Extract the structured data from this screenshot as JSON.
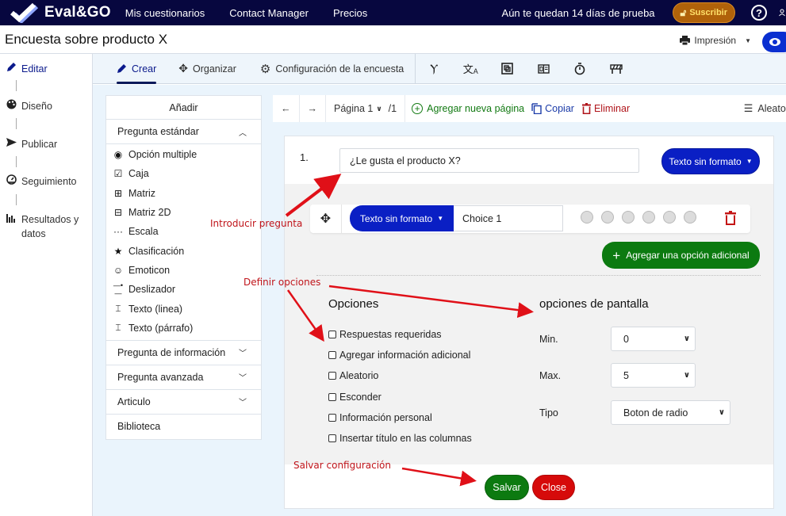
{
  "topnav": {
    "brand": "Eval&GO",
    "links": [
      "Mis cuestionarios",
      "Contact Manager",
      "Precios"
    ],
    "trial_text": "Aún te quedan 14 días de prueba",
    "subscribe_label": "Suscribir",
    "help_icon": "?"
  },
  "titlebar": {
    "survey_title": "Encuesta sobre producto X",
    "print_label": "Impresión"
  },
  "leftnav": {
    "items": [
      {
        "label": "Editar",
        "icon": "pencil-icon",
        "active": true
      },
      {
        "label": "Diseño",
        "icon": "palette-icon"
      },
      {
        "label": "Publicar",
        "icon": "send-icon"
      },
      {
        "label": "Seguimiento",
        "icon": "gauge-icon"
      },
      {
        "label": "Resultados y datos",
        "icon": "bar-chart-icon"
      }
    ]
  },
  "tabs": {
    "items": [
      {
        "label": "Crear",
        "icon": "pencil-icon",
        "active": true
      },
      {
        "label": "Organizar",
        "icon": "move-icon"
      },
      {
        "label": "Configuración de la encuesta",
        "icon": "gear-icon"
      }
    ],
    "tool_icons": [
      "branch-icon",
      "translate-icon",
      "frame-icon",
      "id-card-icon",
      "stopwatch-icon",
      "barrier-icon"
    ]
  },
  "addpanel": {
    "header": "Añadir",
    "standard_section": "Pregunta estándar",
    "question_types": [
      {
        "label": "Opción multiple",
        "icon": "◉"
      },
      {
        "label": "Caja",
        "icon": "☑"
      },
      {
        "label": "Matriz",
        "icon": "⊞"
      },
      {
        "label": "Matriz 2D",
        "icon": "⊟"
      },
      {
        "label": "Escala",
        "icon": "···"
      },
      {
        "label": "Clasificación",
        "icon": "★"
      },
      {
        "label": "Emoticon",
        "icon": "☺"
      },
      {
        "label": "Deslizador",
        "icon": "-•-"
      },
      {
        "label": "Texto (linea)",
        "icon": "⌶"
      },
      {
        "label": "Texto (párrafo)",
        "icon": "⌶"
      }
    ],
    "sections": [
      "Pregunta de información",
      "Pregunta avanzada",
      "Articulo"
    ],
    "library": "Biblioteca"
  },
  "pagebar": {
    "page_label": "Página 1",
    "page_total": "/1",
    "add_page": "Agregar nueva página",
    "copy": "Copiar",
    "delete": "Eliminar",
    "randomize": "Aleatoriz"
  },
  "question": {
    "number": "1.",
    "text": "¿Le gusta el producto X?",
    "format_label": "Texto sin formato",
    "choice_format_label": "Texto sin formato",
    "choice_value": "Choice 1",
    "radio_count": 6,
    "add_option_label": "Agregar una opción adicional"
  },
  "options": {
    "title": "Opciones",
    "items": [
      {
        "label": "Respuestas requeridas",
        "checked": false
      },
      {
        "label": "Agregar información adicional",
        "checked": false
      },
      {
        "label": "Aleatorio",
        "checked": false
      },
      {
        "label": "Esconder",
        "checked": false
      },
      {
        "label": "Información personal",
        "checked": false
      },
      {
        "label": "Insertar título en las columnas",
        "checked": false
      }
    ]
  },
  "display": {
    "title": "opciones de pantalla",
    "min_label": "Min.",
    "min_value": "0",
    "max_label": "Max.",
    "max_value": "5",
    "type_label": "Tipo",
    "type_value": "Boton de radio"
  },
  "actions": {
    "save": "Salvar",
    "close": "Close"
  },
  "annotations": {
    "question": "Introducir pregunta",
    "options": "Definir opciones",
    "save": "Salvar configuración"
  },
  "colors": {
    "nav_bg": "#07073f",
    "primary_blue": "#0a1fc4",
    "green": "#0c7a10",
    "red": "#d60a0a",
    "subscribe": "#b0620a",
    "annotation": "#c0141a"
  }
}
